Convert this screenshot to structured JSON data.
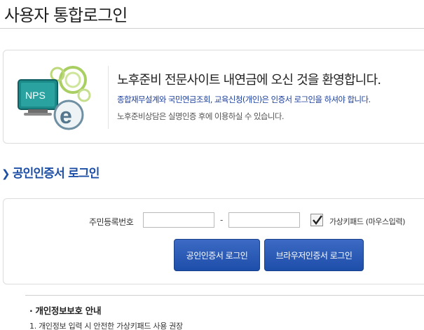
{
  "page": {
    "title": "사용자 통합로그인"
  },
  "welcome": {
    "logo_text": "NPS",
    "logo_icon": "nps-e-logo-icon",
    "heading": "노후준비 전문사이트 내연금에 오신 것을 환영합니다.",
    "line2": "종합재무설계와 국민연금조회, 교육신청(개인)은 인증서 로그인을 하셔야 합니다.",
    "line3": "노후준비상담은 실명인증 후에 이용하실 수 있습니다."
  },
  "section": {
    "icon": "chevron-right-icon",
    "title": "공인인증서 로그인"
  },
  "login": {
    "rrn_label": "주민등록번호",
    "rrn_front_value": "",
    "rrn_dash": "-",
    "rrn_back_value": "",
    "virtual_keypad_checked": true,
    "virtual_keypad_label": "가상키패드 (마우스입력)",
    "cert_login_button": "공인인증서 로그인",
    "browser_cert_login_button": "브라우저인증서 로그인"
  },
  "privacy": {
    "title": "· 개인정보보호 안내",
    "items": [
      "1. 개인정보 입력 시 안전한 가상키패드 사용 권장"
    ]
  },
  "colors": {
    "accent": "#1d4fa6",
    "button": "#2a5bb8",
    "border": "#dcdcdc"
  }
}
